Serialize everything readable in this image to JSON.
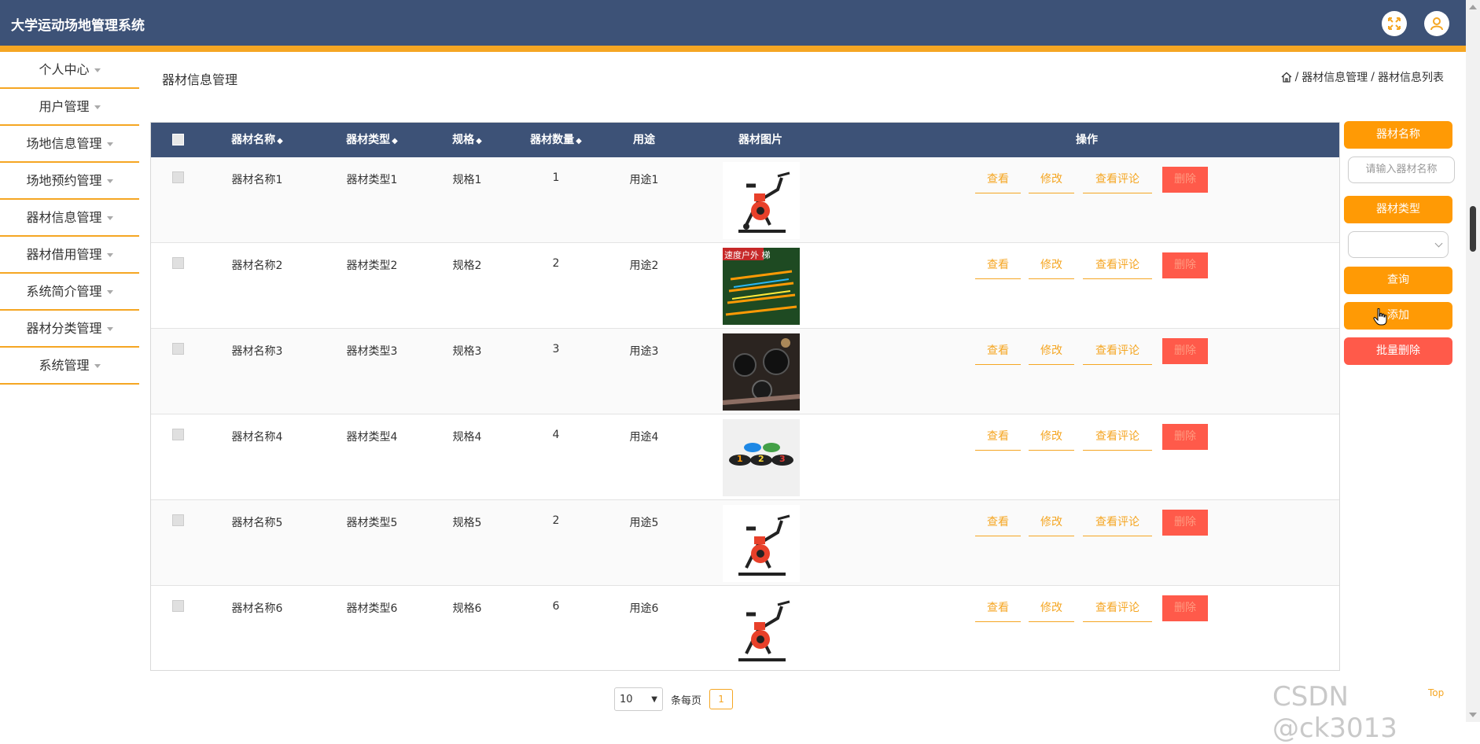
{
  "header": {
    "title": "大学运动场地管理系统"
  },
  "colors": {
    "header": "#3d5277",
    "accent": "#f5a623",
    "danger": "#ff5a4a"
  },
  "sidebar": {
    "items": [
      {
        "label": "个人中心"
      },
      {
        "label": "用户管理"
      },
      {
        "label": "场地信息管理"
      },
      {
        "label": "场地预约管理"
      },
      {
        "label": "器材信息管理"
      },
      {
        "label": "器材借用管理"
      },
      {
        "label": "系统简介管理"
      },
      {
        "label": "器材分类管理"
      },
      {
        "label": "系统管理"
      }
    ]
  },
  "page": {
    "title": "器材信息管理",
    "breadcrumb": {
      "sep": "/",
      "level1": "器材信息管理",
      "level2": "器材信息列表"
    }
  },
  "table": {
    "columns": {
      "name": "器材名称",
      "type": "器材类型",
      "spec": "规格",
      "qty": "器材数量",
      "usage": "用途",
      "image": "器材图片",
      "ops": "操作"
    },
    "sort_glyph": "◆",
    "actions": {
      "view": "查看",
      "edit": "修改",
      "comments": "查看评论",
      "delete": "删除"
    },
    "rows": [
      {
        "name": "器材名称1",
        "type": "器材类型1",
        "spec": "规格1",
        "qty": "1",
        "usage": "用途1",
        "image": "spin-bike"
      },
      {
        "name": "器材名称2",
        "type": "器材类型2",
        "spec": "规格2",
        "qty": "2",
        "usage": "用途2",
        "image": "agility-ladder",
        "image_text": "速度户外 梯"
      },
      {
        "name": "器材名称3",
        "type": "器材类型3",
        "spec": "规格3",
        "qty": "3",
        "usage": "用途3",
        "image": "gym-weights"
      },
      {
        "name": "器材名称4",
        "type": "器材类型4",
        "spec": "规格4",
        "qty": "4",
        "usage": "用途4",
        "image": "number-spots",
        "image_text": [
          "1",
          "2",
          "3"
        ]
      },
      {
        "name": "器材名称5",
        "type": "器材类型5",
        "spec": "规格5",
        "qty": "2",
        "usage": "用途5",
        "image": "spin-bike"
      },
      {
        "name": "器材名称6",
        "type": "器材类型6",
        "spec": "规格6",
        "qty": "6",
        "usage": "用途6",
        "image": "spin-bike"
      }
    ]
  },
  "pagination": {
    "page_size": "10",
    "per_page_label": "条每页",
    "current_page": "1"
  },
  "search": {
    "name_label": "器材名称",
    "name_placeholder": "请输入器材名称",
    "type_label": "器材类型",
    "type_value": "",
    "query_button": "查询",
    "add_button": "添加",
    "batch_delete_button": "批量删除"
  },
  "watermark": "CSDN @ck3013",
  "back_to_top": "Top"
}
